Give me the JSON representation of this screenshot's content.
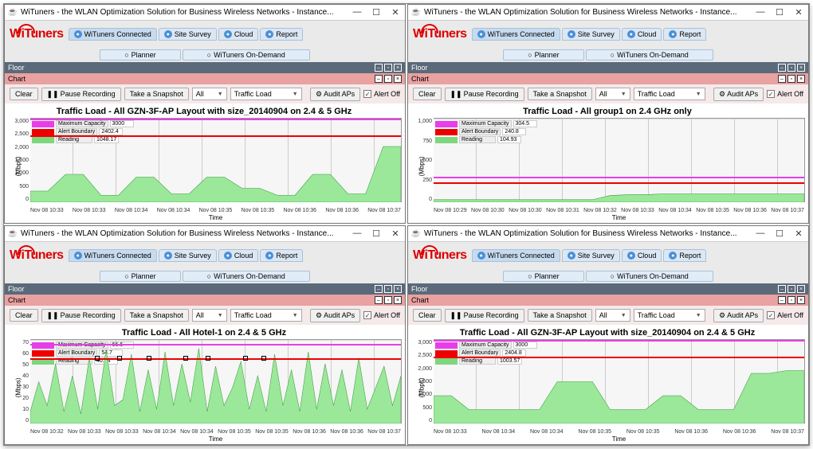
{
  "app_title": "WiTuners - the WLAN Optimization Solution for Business Wireless Networks - Instance...",
  "logo": "WiTuners",
  "main_tabs": [
    "WiTuners Connected",
    "Site Survey",
    "Cloud",
    "Report"
  ],
  "sub_tabs": [
    "Planner",
    "WiTuners On-Demand"
  ],
  "floor_label": "Floor",
  "chart_label": "Chart",
  "toolbar": {
    "clear": "Clear",
    "pause": "Pause Recording",
    "snapshot": "Take a Snapshot",
    "scope": "All",
    "metric": "Traffic Load",
    "audit": "Audit APs",
    "alert": "Alert Off"
  },
  "ylabel": "(Mbps)",
  "xlabel": "Time",
  "panels": [
    {
      "title": "Traffic Load - All GZN-3F-AP Layout with size_20140904 on 2.4 & 5 GHz",
      "yticks": [
        "3,000",
        "2,500",
        "2,000",
        "1,500",
        "1,000",
        "500",
        "0"
      ],
      "xticks": [
        "Nov 08 10:33",
        "Nov 08 10:33",
        "Nov 08 10:34",
        "Nov 08 10:34",
        "Nov 08 10:35",
        "Nov 08 10:35",
        "Nov 08 10:36",
        "Nov 08 10:36",
        "Nov 08 10:37"
      ],
      "legend": {
        "max_cap": "Maximum Capacity",
        "max_cap_v": "3000",
        "alert": "Alert Boundary",
        "alert_v": "2402.4",
        "reading": "Reading",
        "reading_v": "1048.17"
      },
      "chart_data": {
        "type": "area",
        "ylim": [
          0,
          3000
        ],
        "alert": 2402.4,
        "max_cap": 3000,
        "values": [
          400,
          400,
          1000,
          1000,
          250,
          250,
          900,
          900,
          300,
          300,
          900,
          900,
          500,
          500,
          250,
          250,
          1000,
          1000,
          300,
          300,
          2000,
          2000
        ]
      }
    },
    {
      "title": "Traffic Load - All group1 on 2.4 GHz only",
      "yticks": [
        "1,000",
        "750",
        "500",
        "250",
        "0"
      ],
      "xticks": [
        "Nov 08 10:29",
        "Nov 08 10:30",
        "Nov 08 10:30",
        "Nov 08 10:31",
        "Nov 08 10:32",
        "Nov 08 10:33",
        "Nov 08 10:34",
        "Nov 08 10:35",
        "Nov 08 10:36",
        "Nov 08 10:37"
      ],
      "legend": {
        "max_cap": "Maximum Capacity",
        "max_cap_v": "304.5",
        "alert": "Alert Boundary",
        "alert_v": "240.8",
        "reading": "Reading",
        "reading_v": "104.93"
      },
      "chart_data": {
        "type": "area",
        "ylim": [
          0,
          1000
        ],
        "alert": 240.8,
        "max_cap": 304.5,
        "values": [
          30,
          30,
          30,
          30,
          30,
          30,
          30,
          30,
          30,
          30,
          80,
          90,
          90,
          100,
          100,
          100,
          100,
          100,
          100,
          100,
          100,
          100
        ]
      }
    },
    {
      "title": "Traffic Load - All Hotel-1 on 2.4 & 5 GHz",
      "yticks": [
        "70",
        "60",
        "50",
        "40",
        "30",
        "20",
        "10",
        "0"
      ],
      "xticks": [
        "Nov 08 10:32",
        "Nov 08 10:33",
        "Nov 08 10:33",
        "Nov 08 10:34",
        "Nov 08 10:34",
        "Nov 08 10:35",
        "Nov 08 10:35",
        "Nov 08 10:36",
        "Nov 08 10:36",
        "Nov 08 10:37"
      ],
      "legend": {
        "max_cap": "Maximum Capacity",
        "max_cap_v": "66.6",
        "alert": "Alert Boundary",
        "alert_v": "54.7",
        "reading": "Reading",
        "reading_v": "40.24"
      },
      "chart_data": {
        "type": "area",
        "ylim": [
          0,
          70
        ],
        "alert": 54.7,
        "max_cap": 66.6,
        "values": [
          10,
          35,
          15,
          50,
          10,
          40,
          8,
          55,
          12,
          62,
          15,
          20,
          58,
          10,
          45,
          12,
          60,
          15,
          50,
          18,
          63,
          10,
          48,
          15,
          30,
          52,
          12,
          40,
          10,
          58,
          15,
          45,
          10,
          60,
          12,
          50,
          15,
          45,
          10,
          55,
          12,
          30,
          48,
          15,
          40
        ],
        "markers": [
          {
            "x": 0.18,
            "y": 55
          },
          {
            "x": 0.24,
            "y": 55
          },
          {
            "x": 0.32,
            "y": 55
          },
          {
            "x": 0.42,
            "y": 55
          },
          {
            "x": 0.48,
            "y": 55
          },
          {
            "x": 0.58,
            "y": 55
          },
          {
            "x": 0.63,
            "y": 55
          }
        ]
      }
    },
    {
      "title": "Traffic Load - All GZN-3F-AP Layout with size_20140904 on 2.4 & 5 GHz",
      "yticks": [
        "3,000",
        "2,500",
        "2,000",
        "1,500",
        "1,000",
        "500",
        "0"
      ],
      "xticks": [
        "Nov 08 10:33",
        "Nov 08 10:34",
        "Nov 08 10:34",
        "Nov 08 10:35",
        "Nov 08 10:35",
        "Nov 08 10:36",
        "Nov 08 10:36",
        "Nov 08 10:37"
      ],
      "legend": {
        "max_cap": "Maximum Capacity",
        "max_cap_v": "3000",
        "alert": "Alert Boundary",
        "alert_v": "2404.8",
        "reading": "Reading",
        "reading_v": "1003.57"
      },
      "chart_data": {
        "type": "area",
        "ylim": [
          0,
          3000
        ],
        "alert": 2404.8,
        "max_cap": 3000,
        "values": [
          1000,
          1000,
          500,
          500,
          500,
          500,
          500,
          1500,
          1500,
          1500,
          500,
          500,
          500,
          1000,
          1000,
          500,
          500,
          500,
          1800,
          1800,
          1900,
          1900
        ]
      }
    }
  ]
}
